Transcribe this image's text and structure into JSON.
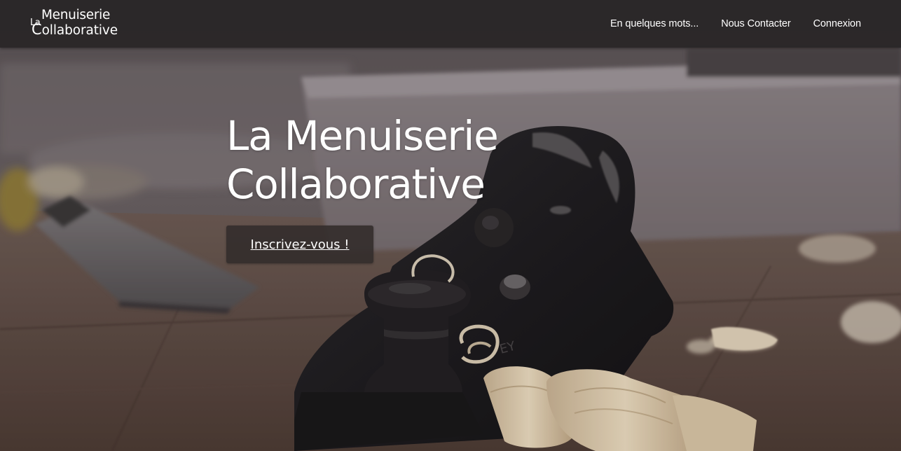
{
  "brand": {
    "small": "La",
    "top": "Menuiserie",
    "bottom_first": "C",
    "bottom_rest": "ollaborative"
  },
  "nav": {
    "items": [
      {
        "label": "En quelques mots..."
      },
      {
        "label": "Nous Contacter"
      },
      {
        "label": "Connexion"
      }
    ]
  },
  "hero": {
    "title_line1": "La Menuiserie",
    "title_line2": "Collaborative",
    "cta_label": "Inscrivez-vous !",
    "background_image": "wood-plane-on-workbench-photo"
  },
  "colors": {
    "navbar_bg": "#282526",
    "text": "#ffffff",
    "cta_bg": "#342e2d"
  }
}
